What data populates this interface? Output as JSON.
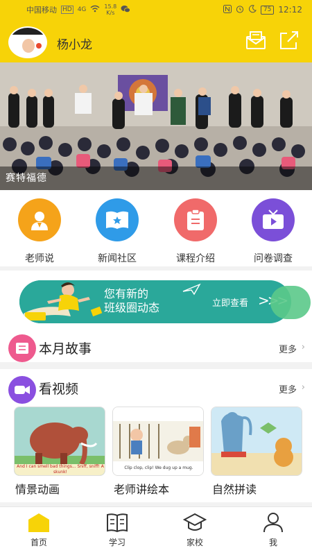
{
  "status_bar": {
    "carrier": "中国移动",
    "hd": "HD",
    "net": "4G",
    "speed_value": "15.8",
    "speed_unit": "K/s",
    "battery": "75",
    "time": "12:12"
  },
  "header": {
    "user_name": "杨小龙"
  },
  "banner": {
    "caption": "赛特福德"
  },
  "quick_menu": [
    {
      "label": "老师说",
      "color": "#f5a31a"
    },
    {
      "label": "新闻社区",
      "color": "#2f9be8"
    },
    {
      "label": "课程介绍",
      "color": "#f06a6a"
    },
    {
      "label": "问卷调查",
      "color": "#7b4fd8"
    }
  ],
  "notice": {
    "line1": "您有新的",
    "line2": "班级圈动态",
    "link": "立即查看",
    "arrows": ">>>"
  },
  "sections": {
    "story": {
      "title": "本月故事",
      "more": "更多",
      "chevron": "›"
    },
    "video": {
      "title": "看视频",
      "more": "更多",
      "chevron": "›"
    }
  },
  "video_cards": [
    {
      "label": "情景动画",
      "caption": "And I can smell bad things... Sniff, sniff! A skunk!"
    },
    {
      "label": "老师讲绘本",
      "caption": "Clip clop, clip! We dug up a mug."
    },
    {
      "label": "自然拼读"
    }
  ],
  "bottom_nav": [
    {
      "label": "首页",
      "icon": "home-icon",
      "active": true
    },
    {
      "label": "学习",
      "icon": "book-icon",
      "active": false
    },
    {
      "label": "家校",
      "icon": "graduation-cap-icon",
      "active": false
    },
    {
      "label": "我",
      "icon": "person-icon",
      "active": false
    }
  ],
  "colors": {
    "brand_yellow": "#f7d308",
    "notice_teal": "#2aa89a",
    "story_icon": "#ee5a8e",
    "video_icon": "#8a4fe0"
  }
}
